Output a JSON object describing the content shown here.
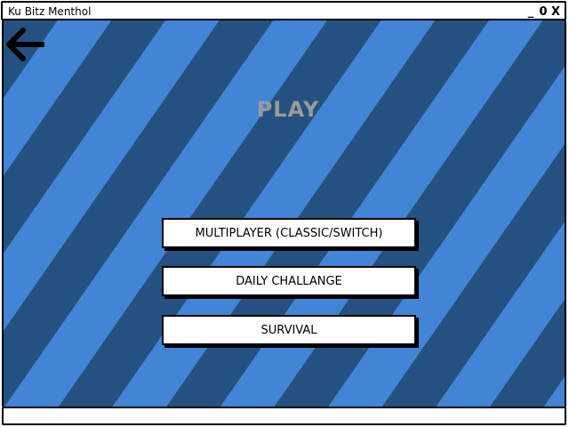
{
  "window": {
    "title": "Ku Bitz Menthol",
    "controls": {
      "minimize": "_",
      "maximize": "0",
      "close": "X"
    }
  },
  "screen": {
    "title": "PLAY",
    "back_icon": "arrow-left-icon"
  },
  "menu": {
    "buttons": [
      {
        "label": "MULTIPLAYER (CLASSIC/SWITCH)"
      },
      {
        "label": "DAILY CHALLANGE"
      },
      {
        "label": "SURVIVAL"
      }
    ]
  },
  "colors": {
    "stripe_light": "#4285d6",
    "stripe_dark": "#24517f",
    "title": "#9a9a9a"
  },
  "statusbar": {
    "text": ""
  }
}
